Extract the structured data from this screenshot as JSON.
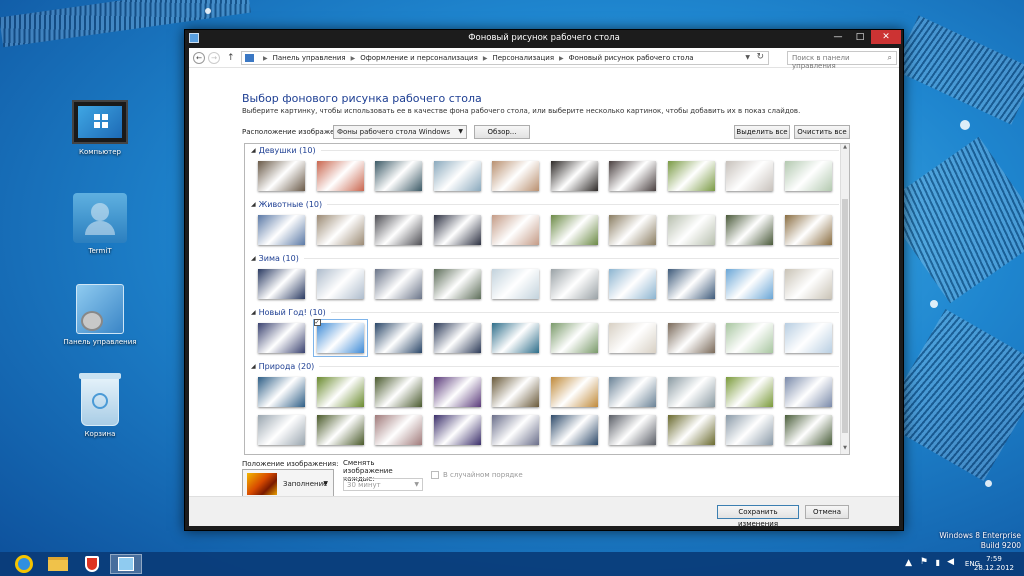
{
  "desktop": {
    "icons": [
      {
        "label": "Компьютер"
      },
      {
        "label": "TermiT"
      },
      {
        "label": "Панель управления"
      },
      {
        "label": "Корзина"
      }
    ],
    "watermark": {
      "line1": "Windows 8 Enterprise",
      "line2": "Build 9200"
    }
  },
  "window": {
    "title": "Фоновый рисунок рабочего стола",
    "buttons": {
      "minimize": "—",
      "maximize": "□",
      "close": "✕"
    }
  },
  "nav": {
    "back": "←",
    "forward": "→",
    "up": "↑",
    "breadcrumb": [
      "Панель управления",
      "Оформление и персонализация",
      "Персонализация",
      "Фоновый рисунок рабочего стола"
    ],
    "search_placeholder": "Поиск в панели управления"
  },
  "main": {
    "heading": "Выбор фонового рисунка рабочего стола",
    "description": "Выберите картинку, чтобы использовать ее в качестве фона рабочего стола, или выберите несколько картинок, чтобы добавить их в показ слайдов.",
    "location_label": "Расположение изображения:",
    "location_value": "Фоны рабочего стола Windows",
    "browse_button": "Обзор...",
    "select_all_button": "Выделить все",
    "clear_all_button": "Очистить все"
  },
  "gallery": {
    "groups": [
      {
        "name": "Девушки (10)",
        "colors": [
          "#6a5a48",
          "#c9664f",
          "#3c5a66",
          "#8aa9bd",
          "#b99070",
          "#2e2a28",
          "#4a4040",
          "#7a9a44",
          "#c7c1bb",
          "#b3c9b0"
        ]
      },
      {
        "name": "Животные (10)",
        "colors": [
          "#5b79a6",
          "#9b8a74",
          "#4e4e54",
          "#2d3142",
          "#c49b86",
          "#6c8a46",
          "#8a7d62",
          "#b7bfae",
          "#4a5a3a",
          "#8a6e42"
        ]
      },
      {
        "name": "Зима (10)",
        "colors": [
          "#2a3a62",
          "#aebccc",
          "#6a7488",
          "#5e6e5a",
          "#c2d2dc",
          "#9aa2a6",
          "#8cb4d0",
          "#3e5a7a",
          "#6aa6d6",
          "#c9c3b6"
        ]
      },
      {
        "name": "Новый Год! (10)",
        "colors": [
          "#3a4270",
          "#3e8ad6",
          "#2a4668",
          "#2c3a58",
          "#2e6e8a",
          "#7a9a6a",
          "#d8d0c4",
          "#7a6a5a",
          "#a8c6a0",
          "#b8cee2"
        ]
      },
      {
        "name": "Природа (20)",
        "colors": [
          "#2e5e86",
          "#6a8a2e",
          "#4a5a2e",
          "#5a3a7a",
          "#6a5a3a",
          "#c08a3a",
          "#6a8296",
          "#8a9aa2",
          "#7a9a3a",
          "#7a8aaa"
        ]
      }
    ],
    "extra_row": {
      "colors": [
        "#9aa6b0",
        "#4a5a2a",
        "#a07a7a",
        "#3a2e6a",
        "#6a6e8a",
        "#2e4a6a",
        "#5a5e66",
        "#6a6a2e",
        "#8a9aa8",
        "#4a5e3a"
      ]
    },
    "selected_group": 3,
    "selected_index": 1
  },
  "position": {
    "label": "Положение изображения:",
    "value": "Заполнение"
  },
  "interval": {
    "label": "Сменять изображение каждые:",
    "value": "30 минут",
    "shuffle_label": "В случайном порядке"
  },
  "footer": {
    "save": "Сохранить изменения",
    "cancel": "Отмена"
  },
  "taskbar": {
    "lang": "ENG",
    "time": "7:59",
    "date": "28.12.2012"
  }
}
